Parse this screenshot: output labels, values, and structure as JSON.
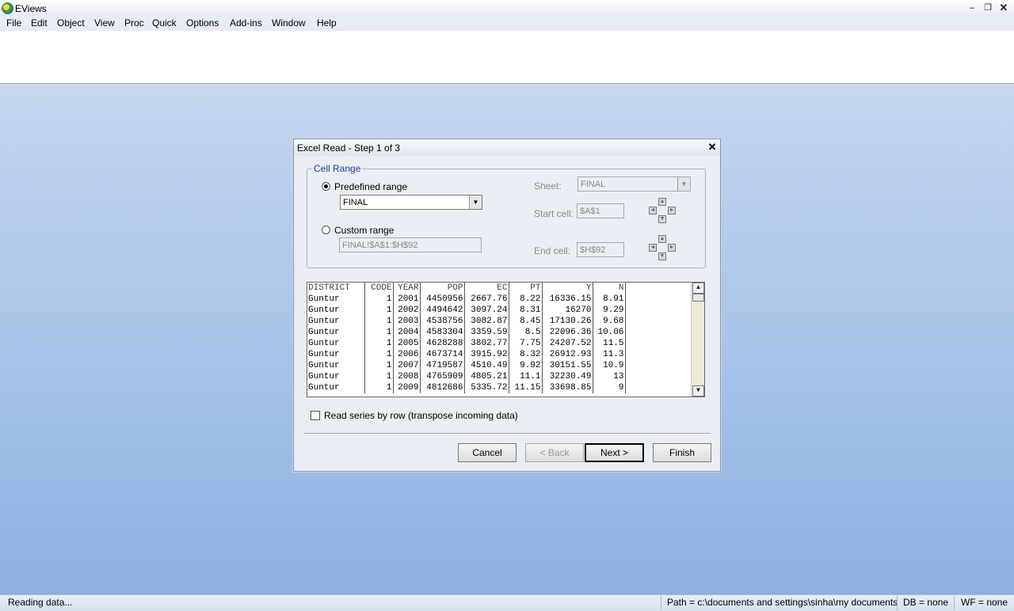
{
  "app": {
    "title": "EViews"
  },
  "menu": [
    "File",
    "Edit",
    "Object",
    "View",
    "Proc",
    "Quick",
    "Options",
    "Add-ins",
    "Window",
    "Help"
  ],
  "window_controls": {
    "minimize": "–",
    "restore": "❐",
    "close": "✕"
  },
  "dialog": {
    "title": "Excel Read - Step 1 of 3",
    "close_glyph": "✕",
    "cell_range": {
      "legend": "Cell Range",
      "predefined_label": "Predefined range",
      "predefined_value": "FINAL",
      "predefined_selected": true,
      "custom_label": "Custom range",
      "custom_value": "FINAL!$A$1:$H$92",
      "sheet_label": "Sheet:",
      "sheet_value": "FINAL",
      "start_label": "Start cell:",
      "start_value": "$A$1",
      "end_label": "End cell:",
      "end_value": "$H$92"
    },
    "preview": {
      "headers": [
        "DISTRICT",
        "CODE",
        "YEAR",
        "POP",
        "EC",
        "PT",
        "Y",
        "N"
      ],
      "rows": [
        [
          "Guntur",
          "1",
          "2001",
          "4450956",
          "2667.76",
          "8.22",
          "16336.15",
          "8.91"
        ],
        [
          "Guntur",
          "1",
          "2002",
          "4494642",
          "3097.24",
          "8.31",
          "16270",
          "9.29"
        ],
        [
          "Guntur",
          "1",
          "2003",
          "4538756",
          "3082.87",
          "8.45",
          "17130.26",
          "9.68"
        ],
        [
          "Guntur",
          "1",
          "2004",
          "4583304",
          "3359.59",
          "8.5",
          "22096.36",
          "10.06"
        ],
        [
          "Guntur",
          "1",
          "2005",
          "4628288",
          "3802.77",
          "7.75",
          "24207.52",
          "11.5"
        ],
        [
          "Guntur",
          "1",
          "2006",
          "4673714",
          "3915.92",
          "8.32",
          "26912.93",
          "11.3"
        ],
        [
          "Guntur",
          "1",
          "2007",
          "4719587",
          "4510.49",
          "9.92",
          "30151.55",
          "10.9"
        ],
        [
          "Guntur",
          "1",
          "2008",
          "4765909",
          "4805.21",
          "11.1",
          "32230.49",
          "13"
        ],
        [
          "Guntur",
          "1",
          "2009",
          "4812686",
          "5335.72",
          "11.15",
          "33698.85",
          "9"
        ]
      ]
    },
    "transpose_label": "Read series by row (transpose incoming data)",
    "transpose_checked": false,
    "buttons": {
      "cancel": "Cancel",
      "back": "< Back",
      "next": "Next >",
      "finish": "Finish"
    }
  },
  "status": {
    "message": "Reading data...",
    "path": "Path = c:\\documents and settings\\sinha\\my documents",
    "db": "DB = none",
    "wf": "WF = none"
  }
}
